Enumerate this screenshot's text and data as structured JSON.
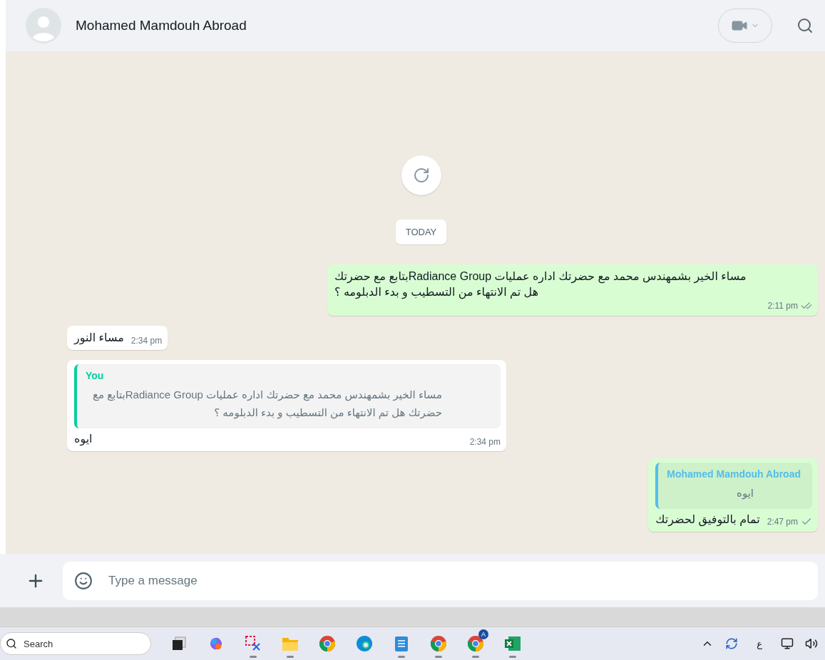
{
  "chat": {
    "contact_name": "Mohamed Mamdouh Abroad"
  },
  "date_badge": "TODAY",
  "messages": [
    {
      "kind": "out",
      "text": "مساء الخير بشمهندس محمد مع  حضرتك اداره عمليات Radiance Groupبتابع مع حضرتك هل تم الانتهاء من التسطيب و بدء الدبلومه ؟",
      "time": "2:11 pm",
      "delivered": true
    },
    {
      "kind": "in",
      "text": "مساء النور",
      "time": "2:34 pm"
    },
    {
      "kind": "in",
      "quote": {
        "author": "You",
        "color": "#06cf9c",
        "text": "مساء الخير بشمهندس محمد مع  حضرتك اداره عمليات Radiance Groupبتابع مع حضرتك هل تم الانتهاء من التسطيب و بدء الدبلومه ؟"
      },
      "text": "ايوه",
      "time": "2:34 pm"
    },
    {
      "kind": "out",
      "quote": {
        "author": "Mohamed Mamdouh Abroad",
        "color": "#53bdeb",
        "text": "ايوه"
      },
      "text": "تمام بالتوفيق لحضرتك",
      "time": "2:47 pm",
      "delivered": false
    }
  ],
  "composer": {
    "placeholder": "Type a message"
  },
  "taskbar": {
    "search_placeholder": "Search",
    "apps": [
      {
        "kind": "taskview",
        "running": false
      },
      {
        "kind": "copilot",
        "running": false
      },
      {
        "kind": "snip",
        "running": true
      },
      {
        "kind": "files",
        "running": true
      },
      {
        "kind": "chrome",
        "running": false
      },
      {
        "kind": "edge",
        "running": false
      },
      {
        "kind": "notepad",
        "running": true
      },
      {
        "kind": "chrome",
        "running": true
      },
      {
        "kind": "chrome",
        "running": true,
        "badge": "A"
      },
      {
        "kind": "excel",
        "running": true
      }
    ],
    "language": "ع"
  }
}
